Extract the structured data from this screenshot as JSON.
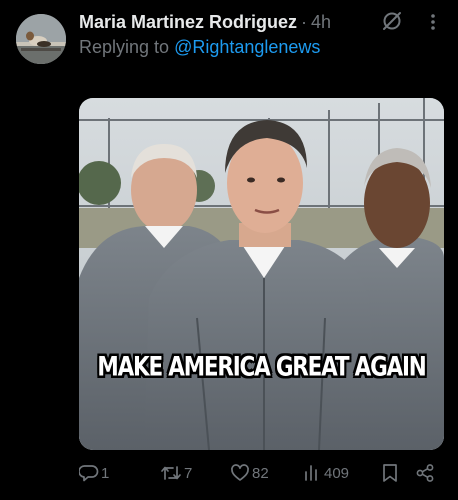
{
  "tweet": {
    "display_name": "Maria Martinez Rodriguez",
    "separator": "·",
    "time": "4h",
    "replying_prefix": "Replying to ",
    "replying_handle": "@Rightanglenews",
    "media_caption": "MAKE AMERICA GREAT AGAIN"
  },
  "actions": {
    "replies": "1",
    "reposts": "7",
    "likes": "82",
    "views": "409"
  },
  "icons": {
    "header": [
      "grok-icon",
      "more-icon"
    ],
    "actions": [
      "reply-icon",
      "repost-icon",
      "like-icon",
      "views-icon",
      "bookmark-icon",
      "share-icon"
    ]
  },
  "colors": {
    "background": "#000000",
    "text_primary": "#e7e9ea",
    "text_secondary": "#71767b",
    "link": "#1d9bf0"
  }
}
